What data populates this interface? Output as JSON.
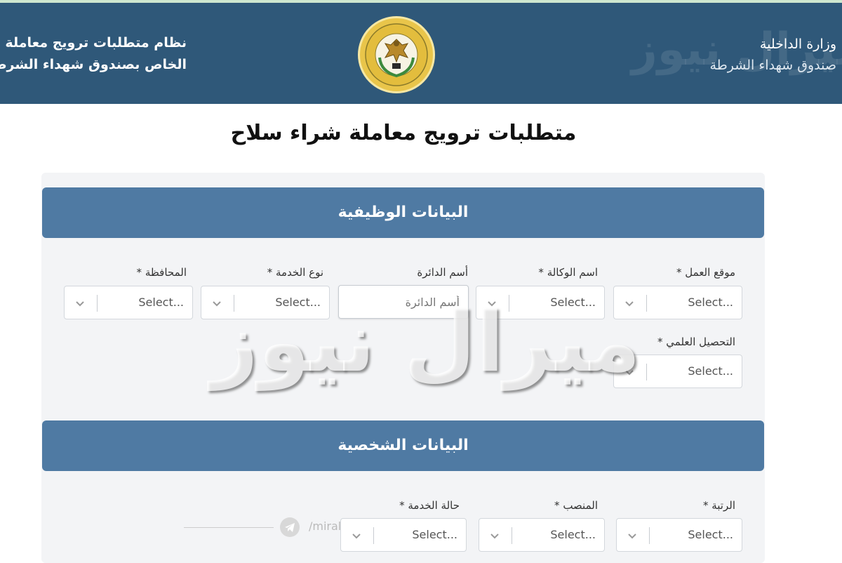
{
  "header": {
    "ministry": "وزارة الداخلية",
    "fund": "صندوق شهداء الشرطة",
    "system_line1": "نظام متطلبات ترويج معاملة بيع الأسلحة",
    "system_line2": "الخاص بصندوق شهداء الشرطة",
    "emblem_icon": "police-emblem-icon"
  },
  "page": {
    "title": "متطلبات ترويج معاملة شراء سلاح"
  },
  "sections": {
    "job": {
      "title": "البيانات الوظيفية",
      "fields": {
        "work_location": {
          "label": "موقع العمل *",
          "value": "Select..."
        },
        "agency_name": {
          "label": "اسم الوكالة *",
          "value": "Select..."
        },
        "department_name": {
          "label": "أسم الدائرة",
          "placeholder": "أسم الدائرة"
        },
        "service_type": {
          "label": "نوع الخدمة *",
          "value": "Select..."
        },
        "governorate": {
          "label": "المحافظة *",
          "value": "Select..."
        },
        "education": {
          "label": "التحصيل العلمي *",
          "value": "Select..."
        }
      }
    },
    "personal": {
      "title": "البيانات الشخصية",
      "fields": {
        "rank": {
          "label": "الرتبة *",
          "value": "Select..."
        },
        "position": {
          "label": "المنصب *",
          "value": "Select..."
        },
        "service_status": {
          "label": "حالة الخدمة *",
          "value": "Select..."
        }
      }
    }
  },
  "watermark": {
    "text": "ميرال نيوز",
    "footer_text": "/miral"
  },
  "colors": {
    "header_bg": "#2f5879",
    "section_bg": "#4f7aa3",
    "card_bg": "#f3f4f6"
  }
}
